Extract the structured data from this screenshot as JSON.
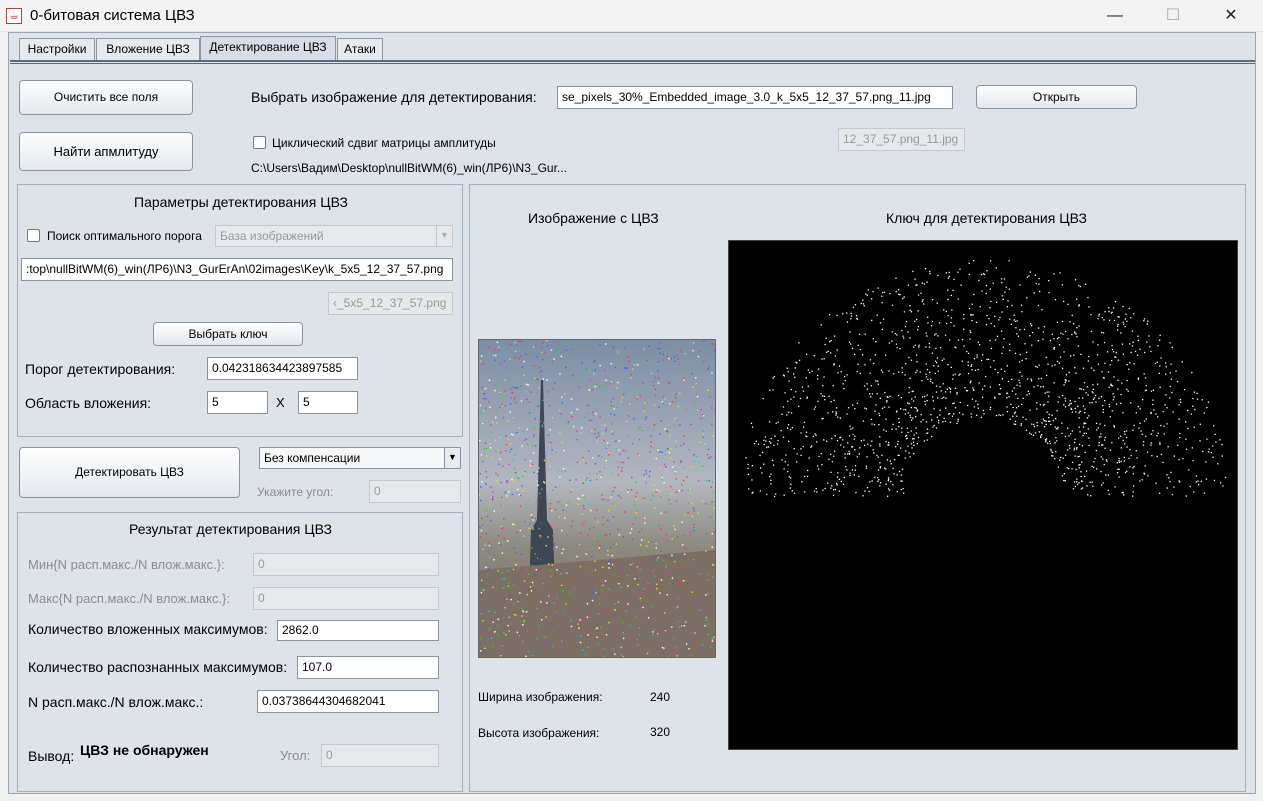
{
  "window": {
    "title": "0-битовая система ЦВЗ",
    "app_icon": "java-cup-icon",
    "controls": {
      "minimize": "—",
      "maximize": "☐",
      "close": "✕"
    }
  },
  "tabs": [
    {
      "label": "Настройки",
      "active": false
    },
    {
      "label": "Вложение ЦВЗ",
      "active": false
    },
    {
      "label": "Детектирование ЦВЗ",
      "active": true
    },
    {
      "label": "Атаки",
      "active": false
    }
  ],
  "top": {
    "clear_button": "Очистить все поля",
    "find_amplitude_button": "Найти апмлитуду",
    "select_image_label": "Выбрать изображение для детектирования:",
    "image_path_value": "se_pixels_30%_Embedded_image_3.0_k_5x5_12_37_57.png_11.jpg",
    "open_button": "Открыть",
    "image_filename_short": "12_37_57.png_11.jpg",
    "cyclic_shift_label": "Циклический сдвиг матрицы амплитуды",
    "cyclic_shift_checked": false,
    "path_text": "C:\\Users\\Вадим\\Desktop\\nullBitWM(6)_win(ЛР6)\\N3_Gur..."
  },
  "params": {
    "title": "Параметры детектирования ЦВЗ",
    "optimal_threshold_label": "Поиск оптимального порога",
    "optimal_threshold_checked": false,
    "image_db_combo": "База изображений",
    "key_path_value": ":top\\nullBitWM(6)_win(ЛР6)\\N3_GurErAn\\02images\\Key\\k_5x5_12_37_57.png",
    "key_filename_short": "‹_5x5_12_37_57.png",
    "select_key_button": "Выбрать ключ",
    "threshold_label": "Порог детектирования:",
    "threshold_value": "0.042318634423897585",
    "embed_area_label": "Область вложения:",
    "embed_area_w": "5",
    "embed_area_x": "X",
    "embed_area_h": "5"
  },
  "detect": {
    "detect_button": "Детектировать ЦВЗ",
    "compensation_combo": "Без компенсации",
    "angle_label": "Укажите угол:",
    "angle_value": "0"
  },
  "result": {
    "title": "Результат детектирования ЦВЗ",
    "min_label": "Мин{N расп.макс./N влож.макс.}:",
    "min_value": "0",
    "max_label": "Макс{N расп.макс./N влож.макс.}:",
    "max_value": "0",
    "embedded_count_label": "Количество вложенных максимумов:",
    "embedded_count_value": "2862.0",
    "recognized_count_label": "Количество распознанных максимумов:",
    "recognized_count_value": "107.0",
    "ratio_label": "N расп.макс./N влож.макс.:",
    "ratio_value": "0.03738644304682041",
    "conclusion_label": "Вывод:",
    "conclusion_value": "ЦВЗ не обнаружен",
    "angle_label": "Угол:",
    "angle_value": "0"
  },
  "images": {
    "watermarked_title": "Изображение с ЦВЗ",
    "key_title": "Ключ для детектирования ЦВЗ",
    "width_label": "Ширина изображения:",
    "width_value": "240",
    "height_label": "Высота изображения:",
    "height_value": "320"
  },
  "colors": {
    "panel_bg": "#dee3ea",
    "tab_active_bg": "#d7dde6",
    "border": "#8a93a0",
    "accent_line": "#5b6c85"
  }
}
